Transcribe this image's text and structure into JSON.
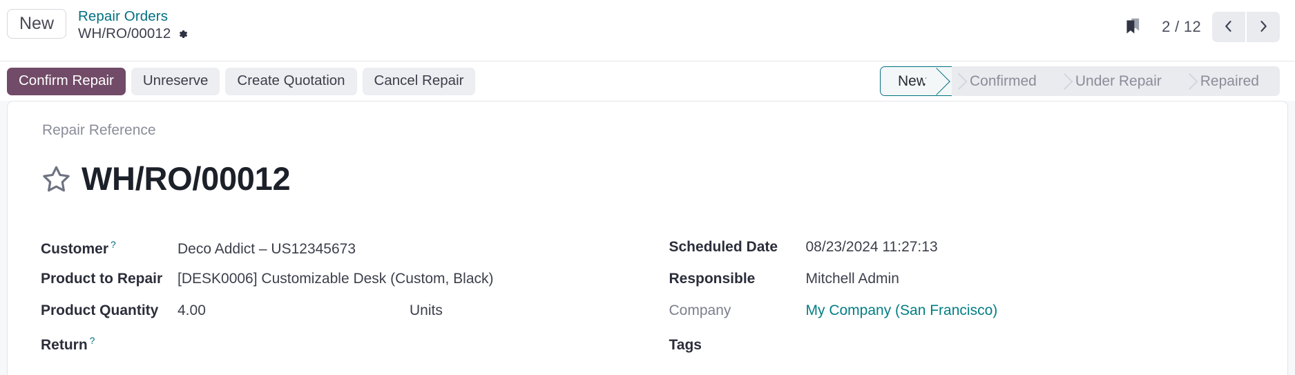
{
  "control_panel": {
    "new_button_label": "New",
    "breadcrumb_parent": "Repair Orders",
    "breadcrumb_current": "WH/RO/00012",
    "settings_icon": "gear-icon",
    "bookmark_icon": "bookmarks-icon",
    "pager": {
      "counter": "2 / 12",
      "current": 2,
      "total": 12,
      "prev_icon": "chevron-left-icon",
      "next_icon": "chevron-right-icon"
    }
  },
  "action_buttons": [
    {
      "label": "Confirm Repair",
      "style": "primary"
    },
    {
      "label": "Unreserve",
      "style": "secondary"
    },
    {
      "label": "Create Quotation",
      "style": "secondary"
    },
    {
      "label": "Cancel Repair",
      "style": "secondary"
    }
  ],
  "statusbar": {
    "active": "New",
    "stages": [
      {
        "label": "New",
        "active": true
      },
      {
        "label": "Confirmed",
        "active": false
      },
      {
        "label": "Under Repair",
        "active": false
      },
      {
        "label": "Repaired",
        "active": false
      }
    ]
  },
  "form": {
    "title_label": "Repair Reference",
    "title_value": "WH/RO/00012",
    "favorite_icon": "star-outline-icon",
    "left_fields": [
      {
        "label": "Customer",
        "help": "?",
        "value": "Deco Addict – US12345673"
      },
      {
        "label": "Product to Repair",
        "help": "",
        "value": "[DESK0006] Customizable Desk (Custom, Black)"
      },
      {
        "label": "Product Quantity",
        "help": "",
        "value": "4.00",
        "uom": "Units"
      },
      {
        "label": "Return",
        "help": "?",
        "value": ""
      }
    ],
    "right_fields": [
      {
        "label": "Scheduled Date",
        "help": "",
        "value": "08/23/2024 11:27:13",
        "muted_label": false,
        "link": false
      },
      {
        "label": "Responsible",
        "help": "",
        "value": "Mitchell Admin",
        "muted_label": false,
        "link": false
      },
      {
        "label": "Company",
        "help": "",
        "value": "My Company (San Francisco)",
        "muted_label": true,
        "link": true
      },
      {
        "label": "Tags",
        "help": "",
        "value": "",
        "muted_label": false,
        "link": false
      }
    ]
  },
  "colors": {
    "primary": "#714b67",
    "accent_teal": "#017e84",
    "secondary_bg": "#eceef1",
    "statusbar_bg": "#e9ebef",
    "page_bg": "#f7f8f9"
  }
}
